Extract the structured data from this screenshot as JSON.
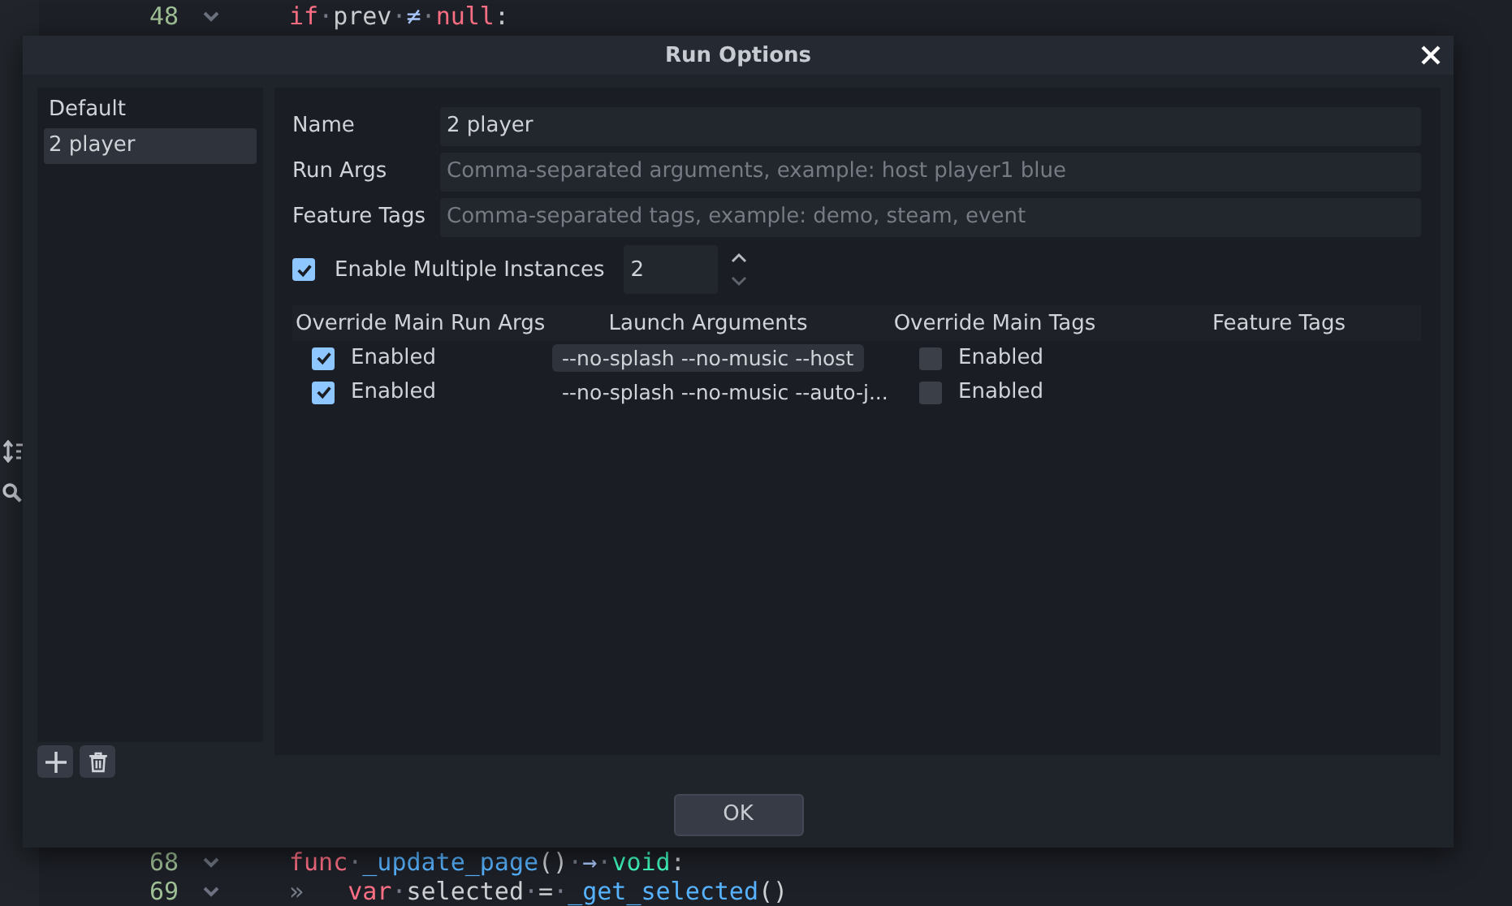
{
  "editor": {
    "top_lines": [
      {
        "number": "48",
        "code": [
          {
            "kind": "keyword",
            "text": "if"
          },
          {
            "kind": "space",
            "text": "·"
          },
          {
            "kind": "plain",
            "text": "prev"
          },
          {
            "kind": "space",
            "text": "·"
          },
          {
            "kind": "operator",
            "text": "≠"
          },
          {
            "kind": "space",
            "text": "·"
          },
          {
            "kind": "keyword",
            "text": "null"
          },
          {
            "kind": "plain",
            "text": ":"
          }
        ]
      }
    ],
    "bottom_lines": [
      {
        "number": "68",
        "code": [
          {
            "kind": "keyword",
            "text": "func"
          },
          {
            "kind": "space",
            "text": "·"
          },
          {
            "kind": "function",
            "text": "_update_page"
          },
          {
            "kind": "plain",
            "text": "()"
          },
          {
            "kind": "space",
            "text": "·"
          },
          {
            "kind": "operator",
            "text": "→"
          },
          {
            "kind": "space",
            "text": "·"
          },
          {
            "kind": "type",
            "text": "void"
          },
          {
            "kind": "plain",
            "text": ":"
          }
        ]
      },
      {
        "number": "69",
        "code": [
          {
            "kind": "space",
            "text": "»   "
          },
          {
            "kind": "keyword",
            "text": "var"
          },
          {
            "kind": "space",
            "text": "·"
          },
          {
            "kind": "plain",
            "text": "selected"
          },
          {
            "kind": "space",
            "text": "·"
          },
          {
            "kind": "plain",
            "text": "="
          },
          {
            "kind": "space",
            "text": "·"
          },
          {
            "kind": "function",
            "text": "_get_selected"
          },
          {
            "kind": "plain",
            "text": "()"
          }
        ]
      }
    ]
  },
  "dialog": {
    "title": "Run Options",
    "configs": [
      {
        "label": "Default",
        "selected": false
      },
      {
        "label": "2 player",
        "selected": true
      }
    ],
    "fields": [
      {
        "label": "Name",
        "value": "2 player"
      },
      {
        "label": "Run Args",
        "placeholder": "Comma-separated arguments, example: host player1 blue"
      },
      {
        "label": "Feature Tags",
        "placeholder": "Comma-separated tags, example: demo, steam, event"
      }
    ],
    "multiple_instances": {
      "label": "Enable Multiple Instances",
      "checked": true,
      "count": "2"
    },
    "table": {
      "columns": [
        "Override Main Run Args",
        "Launch Arguments",
        "Override Main Tags",
        "Feature Tags"
      ],
      "rows": [
        {
          "override_args": {
            "label": "Enabled",
            "checked": true
          },
          "launch_arguments": "--no-splash --no-music --host",
          "selected": true,
          "override_tags": {
            "label": "Enabled",
            "checked": false
          }
        },
        {
          "override_args": {
            "label": "Enabled",
            "checked": true
          },
          "launch_arguments": "--no-splash --no-music --auto-j...",
          "selected": false,
          "override_tags": {
            "label": "Enabled",
            "checked": false
          }
        }
      ]
    },
    "ok_button": "OK"
  }
}
